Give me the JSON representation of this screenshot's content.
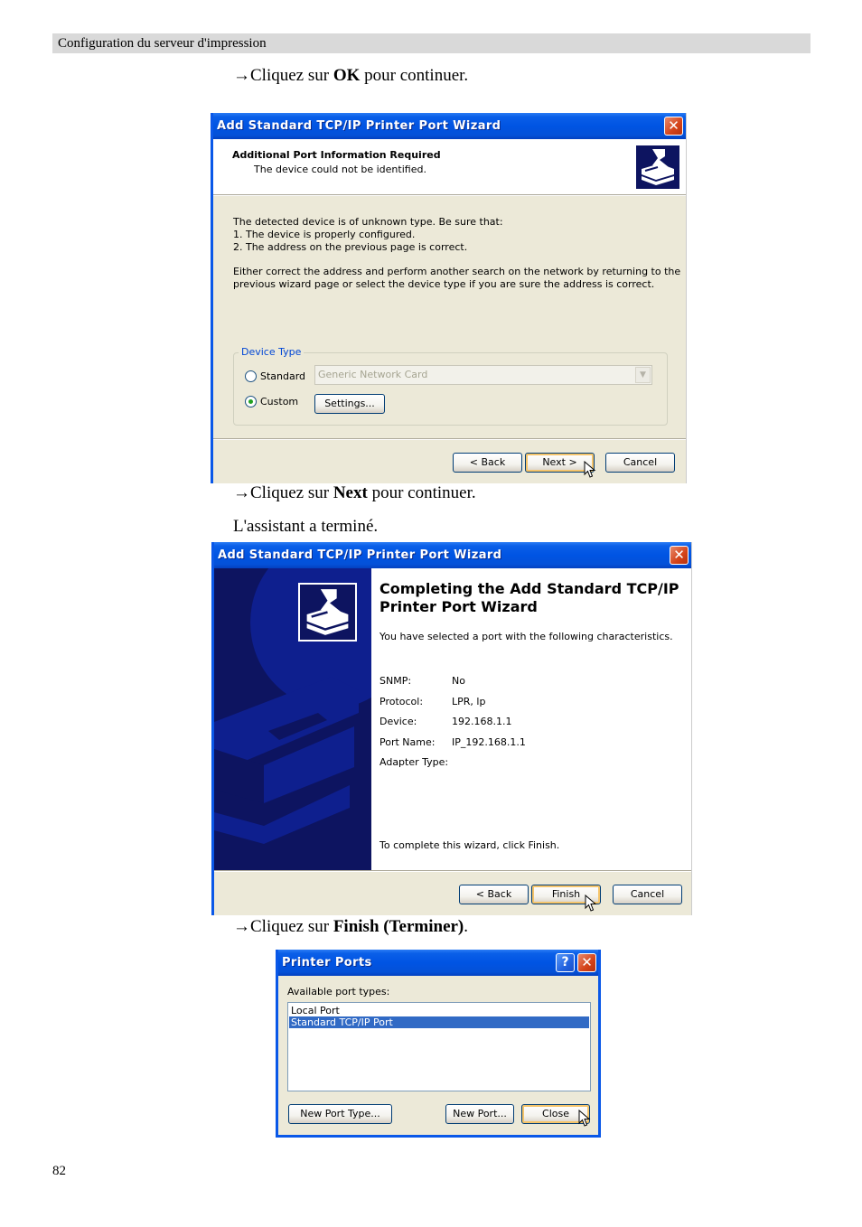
{
  "page": {
    "header": "Configuration du serveur d'impression",
    "page_number": "82",
    "instructions": [
      {
        "arrow": "→",
        "pre": "Cliquez sur ",
        "bold": "OK",
        "post": " pour continuer."
      },
      {
        "arrow": "→",
        "pre": "Cliquez sur ",
        "bold": "Next",
        "post": " pour continuer."
      },
      {
        "text": "L'assistant a terminé."
      },
      {
        "arrow": "→",
        "pre": "Cliquez sur ",
        "bold": "Finish (Terminer)",
        "post": "."
      }
    ]
  },
  "dialog1": {
    "title": "Add Standard TCP/IP Printer Port Wizard",
    "close_glyph": "✕",
    "heading": "Additional Port Information Required",
    "subheading": "The device could not be identified.",
    "body_lines": [
      "The detected device is of unknown type.  Be sure that:",
      "1. The device is properly configured.",
      "2.  The address on the previous page is correct."
    ],
    "body_para": [
      "Either correct the address and perform another search on the network by returning to the",
      "previous wizard page or select the device type if you are sure the address is correct."
    ],
    "group_label": "Device Type",
    "radio_standard": "Standard",
    "radio_custom": "Custom",
    "selected_radio": "Custom",
    "dropdown_value": "Generic Network Card",
    "settings_button": "Settings...",
    "back_button": "< Back",
    "next_button": "Next >",
    "cancel_button": "Cancel"
  },
  "dialog2": {
    "title": "Add Standard TCP/IP Printer Port Wizard",
    "close_glyph": "✕",
    "heading_line1": "Completing the Add Standard TCP/IP",
    "heading_line2": "Printer Port Wizard",
    "intro": "You have selected a port with the following characteristics.",
    "properties": [
      {
        "label": "SNMP:",
        "value": "No"
      },
      {
        "label": "Protocol:",
        "value": "LPR, lp"
      },
      {
        "label": "Device:",
        "value": "192.168.1.1"
      },
      {
        "label": "Port Name:",
        "value": "IP_192.168.1.1"
      },
      {
        "label": "Adapter Type:",
        "value": ""
      }
    ],
    "finish_note": "To complete this wizard, click Finish.",
    "back_button": "< Back",
    "finish_button": "Finish",
    "cancel_button": "Cancel"
  },
  "dialog3": {
    "title": "Printer Ports",
    "help_glyph": "?",
    "close_glyph": "✕",
    "list_label": "Available port types:",
    "port_types": [
      "Local Port",
      "Standard TCP/IP Port"
    ],
    "selected_port": "Standard TCP/IP Port",
    "new_port_type_button": "New Port Type...",
    "new_port_button": "New Port...",
    "close_button": "Close"
  },
  "colors": {
    "title_bar": "#0054e3",
    "dialog_bg": "#ece9d8",
    "selection": "#316ac5",
    "wizard_sidebar": "#0d1460",
    "group_label": "#0046d5"
  }
}
